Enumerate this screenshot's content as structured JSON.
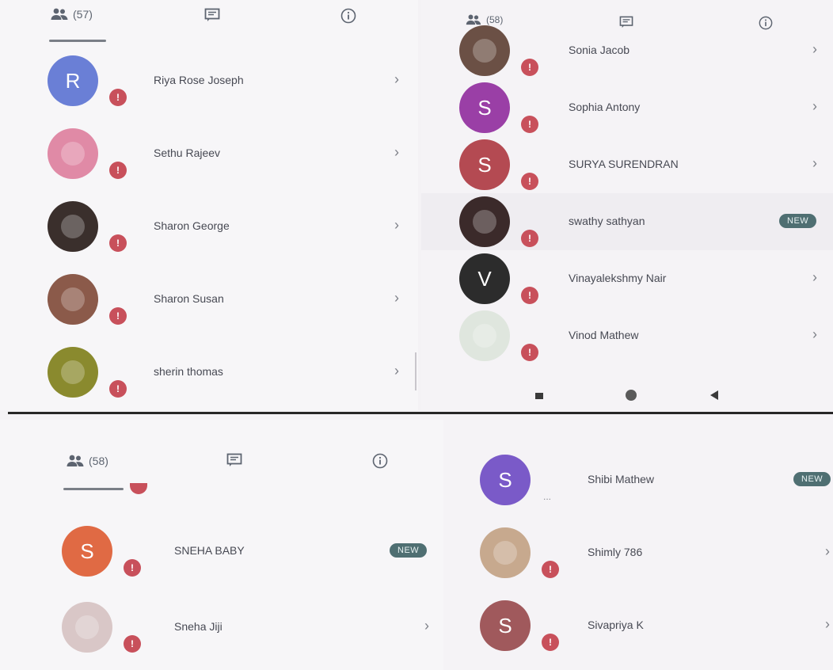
{
  "screens": {
    "top_left": {
      "tabs": {
        "participants_count": "(57)"
      },
      "members": [
        {
          "name": "Riya Rose Joseph",
          "initial": "R",
          "avatar_color": "#6a7fd6"
        },
        {
          "name": "Sethu Rajeev",
          "initial": "",
          "avatar_color": "#e08aa6"
        },
        {
          "name": "Sharon George",
          "initial": "",
          "avatar_color": "#3a2f2c"
        },
        {
          "name": "Sharon Susan",
          "initial": "",
          "avatar_color": "#8b5a4a"
        },
        {
          "name": "sherin thomas",
          "initial": "",
          "avatar_color": "#8a8a2e"
        }
      ]
    },
    "top_right": {
      "tabs": {
        "participants_count": "(58)"
      },
      "members": [
        {
          "name": "Sonia Jacob",
          "initial": "",
          "avatar_color": "#6b5045"
        },
        {
          "name": "Sophia Antony",
          "initial": "S",
          "avatar_color": "#9a3fa6"
        },
        {
          "name": "SURYA SURENDRAN",
          "initial": "S",
          "avatar_color": "#b44a52"
        },
        {
          "name": "swathy sathyan",
          "initial": "",
          "avatar_color": "#3b2a2a",
          "new": "NEW"
        },
        {
          "name": "Vinayalekshmy Nair",
          "initial": "V",
          "avatar_color": "#2c2c2c"
        },
        {
          "name": "Vinod Mathew",
          "initial": "",
          "avatar_color": "#dfe6de"
        }
      ]
    },
    "bottom_left": {
      "tabs": {
        "participants_count": "(58)"
      },
      "members": [
        {
          "name": "SNEHA BABY",
          "initial": "S",
          "avatar_color": "#e06a44",
          "new": "NEW"
        },
        {
          "name": "Sneha Jiji",
          "initial": "",
          "avatar_color": "#d9c7c7"
        }
      ]
    },
    "bottom_right": {
      "members": [
        {
          "name": "Shibi Mathew",
          "initial": "S",
          "avatar_color": "#7a5ac8",
          "new": "NEW",
          "ellipsis": "..."
        },
        {
          "name": "Shimly 786",
          "initial": "",
          "avatar_color": "#c7a98e"
        },
        {
          "name": "Sivapriya K",
          "initial": "S",
          "avatar_color": "#a0595c"
        }
      ]
    }
  },
  "colors": {
    "status_badge": "#c8505b",
    "new_badge": "#4f6f72"
  },
  "icons": {
    "participants": "people-icon",
    "chat": "chat-icon",
    "info": "info-icon",
    "status": "microphone-off-icon",
    "chevron": "chevron-right-icon"
  }
}
